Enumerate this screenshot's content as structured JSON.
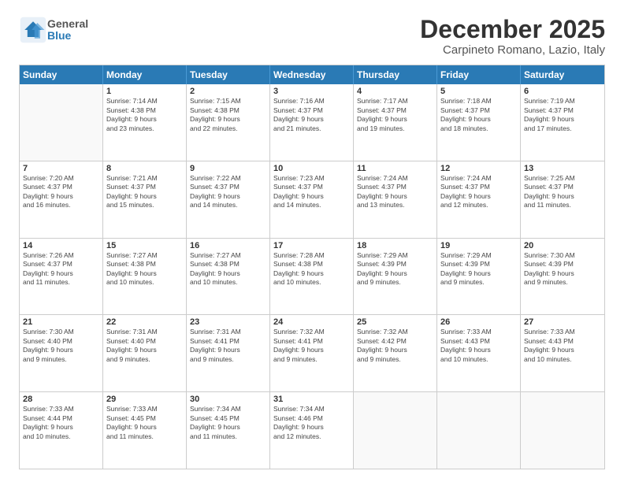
{
  "header": {
    "logo": {
      "general": "General",
      "blue": "Blue"
    },
    "title": "December 2025",
    "location": "Carpineto Romano, Lazio, Italy"
  },
  "days": [
    "Sunday",
    "Monday",
    "Tuesday",
    "Wednesday",
    "Thursday",
    "Friday",
    "Saturday"
  ],
  "weeks": [
    [
      {
        "num": "",
        "lines": []
      },
      {
        "num": "1",
        "lines": [
          "Sunrise: 7:14 AM",
          "Sunset: 4:38 PM",
          "Daylight: 9 hours",
          "and 23 minutes."
        ]
      },
      {
        "num": "2",
        "lines": [
          "Sunrise: 7:15 AM",
          "Sunset: 4:38 PM",
          "Daylight: 9 hours",
          "and 22 minutes."
        ]
      },
      {
        "num": "3",
        "lines": [
          "Sunrise: 7:16 AM",
          "Sunset: 4:37 PM",
          "Daylight: 9 hours",
          "and 21 minutes."
        ]
      },
      {
        "num": "4",
        "lines": [
          "Sunrise: 7:17 AM",
          "Sunset: 4:37 PM",
          "Daylight: 9 hours",
          "and 19 minutes."
        ]
      },
      {
        "num": "5",
        "lines": [
          "Sunrise: 7:18 AM",
          "Sunset: 4:37 PM",
          "Daylight: 9 hours",
          "and 18 minutes."
        ]
      },
      {
        "num": "6",
        "lines": [
          "Sunrise: 7:19 AM",
          "Sunset: 4:37 PM",
          "Daylight: 9 hours",
          "and 17 minutes."
        ]
      }
    ],
    [
      {
        "num": "7",
        "lines": [
          "Sunrise: 7:20 AM",
          "Sunset: 4:37 PM",
          "Daylight: 9 hours",
          "and 16 minutes."
        ]
      },
      {
        "num": "8",
        "lines": [
          "Sunrise: 7:21 AM",
          "Sunset: 4:37 PM",
          "Daylight: 9 hours",
          "and 15 minutes."
        ]
      },
      {
        "num": "9",
        "lines": [
          "Sunrise: 7:22 AM",
          "Sunset: 4:37 PM",
          "Daylight: 9 hours",
          "and 14 minutes."
        ]
      },
      {
        "num": "10",
        "lines": [
          "Sunrise: 7:23 AM",
          "Sunset: 4:37 PM",
          "Daylight: 9 hours",
          "and 14 minutes."
        ]
      },
      {
        "num": "11",
        "lines": [
          "Sunrise: 7:24 AM",
          "Sunset: 4:37 PM",
          "Daylight: 9 hours",
          "and 13 minutes."
        ]
      },
      {
        "num": "12",
        "lines": [
          "Sunrise: 7:24 AM",
          "Sunset: 4:37 PM",
          "Daylight: 9 hours",
          "and 12 minutes."
        ]
      },
      {
        "num": "13",
        "lines": [
          "Sunrise: 7:25 AM",
          "Sunset: 4:37 PM",
          "Daylight: 9 hours",
          "and 11 minutes."
        ]
      }
    ],
    [
      {
        "num": "14",
        "lines": [
          "Sunrise: 7:26 AM",
          "Sunset: 4:37 PM",
          "Daylight: 9 hours",
          "and 11 minutes."
        ]
      },
      {
        "num": "15",
        "lines": [
          "Sunrise: 7:27 AM",
          "Sunset: 4:38 PM",
          "Daylight: 9 hours",
          "and 10 minutes."
        ]
      },
      {
        "num": "16",
        "lines": [
          "Sunrise: 7:27 AM",
          "Sunset: 4:38 PM",
          "Daylight: 9 hours",
          "and 10 minutes."
        ]
      },
      {
        "num": "17",
        "lines": [
          "Sunrise: 7:28 AM",
          "Sunset: 4:38 PM",
          "Daylight: 9 hours",
          "and 10 minutes."
        ]
      },
      {
        "num": "18",
        "lines": [
          "Sunrise: 7:29 AM",
          "Sunset: 4:39 PM",
          "Daylight: 9 hours",
          "and 9 minutes."
        ]
      },
      {
        "num": "19",
        "lines": [
          "Sunrise: 7:29 AM",
          "Sunset: 4:39 PM",
          "Daylight: 9 hours",
          "and 9 minutes."
        ]
      },
      {
        "num": "20",
        "lines": [
          "Sunrise: 7:30 AM",
          "Sunset: 4:39 PM",
          "Daylight: 9 hours",
          "and 9 minutes."
        ]
      }
    ],
    [
      {
        "num": "21",
        "lines": [
          "Sunrise: 7:30 AM",
          "Sunset: 4:40 PM",
          "Daylight: 9 hours",
          "and 9 minutes."
        ]
      },
      {
        "num": "22",
        "lines": [
          "Sunrise: 7:31 AM",
          "Sunset: 4:40 PM",
          "Daylight: 9 hours",
          "and 9 minutes."
        ]
      },
      {
        "num": "23",
        "lines": [
          "Sunrise: 7:31 AM",
          "Sunset: 4:41 PM",
          "Daylight: 9 hours",
          "and 9 minutes."
        ]
      },
      {
        "num": "24",
        "lines": [
          "Sunrise: 7:32 AM",
          "Sunset: 4:41 PM",
          "Daylight: 9 hours",
          "and 9 minutes."
        ]
      },
      {
        "num": "25",
        "lines": [
          "Sunrise: 7:32 AM",
          "Sunset: 4:42 PM",
          "Daylight: 9 hours",
          "and 9 minutes."
        ]
      },
      {
        "num": "26",
        "lines": [
          "Sunrise: 7:33 AM",
          "Sunset: 4:43 PM",
          "Daylight: 9 hours",
          "and 10 minutes."
        ]
      },
      {
        "num": "27",
        "lines": [
          "Sunrise: 7:33 AM",
          "Sunset: 4:43 PM",
          "Daylight: 9 hours",
          "and 10 minutes."
        ]
      }
    ],
    [
      {
        "num": "28",
        "lines": [
          "Sunrise: 7:33 AM",
          "Sunset: 4:44 PM",
          "Daylight: 9 hours",
          "and 10 minutes."
        ]
      },
      {
        "num": "29",
        "lines": [
          "Sunrise: 7:33 AM",
          "Sunset: 4:45 PM",
          "Daylight: 9 hours",
          "and 11 minutes."
        ]
      },
      {
        "num": "30",
        "lines": [
          "Sunrise: 7:34 AM",
          "Sunset: 4:45 PM",
          "Daylight: 9 hours",
          "and 11 minutes."
        ]
      },
      {
        "num": "31",
        "lines": [
          "Sunrise: 7:34 AM",
          "Sunset: 4:46 PM",
          "Daylight: 9 hours",
          "and 12 minutes."
        ]
      },
      {
        "num": "",
        "lines": []
      },
      {
        "num": "",
        "lines": []
      },
      {
        "num": "",
        "lines": []
      }
    ]
  ]
}
